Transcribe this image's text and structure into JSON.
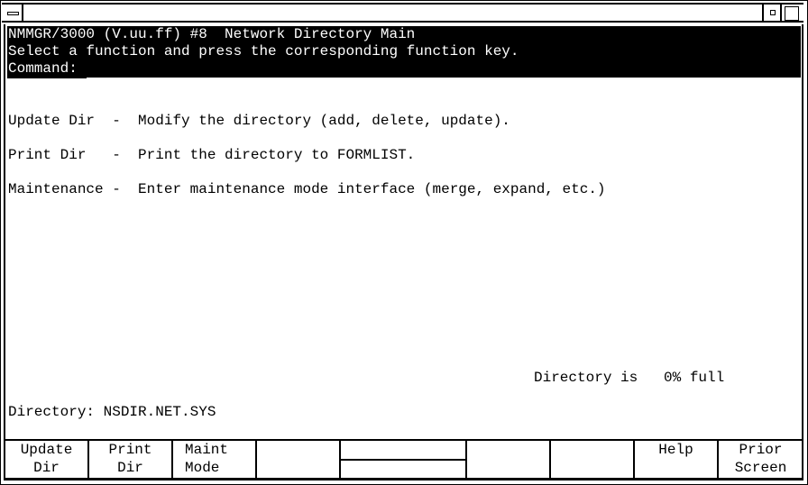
{
  "header": {
    "title": "NMMGR/3000 (V.uu.ff) #8  Network Directory Main",
    "instruction": "Select a function and press the corresponding function key.",
    "command_label": "Command:",
    "command_value": ""
  },
  "menu": [
    {
      "label": "Update Dir  ",
      "sep": "-",
      "desc": "Modify the directory (add, delete, update)."
    },
    {
      "label": "Print Dir   ",
      "sep": "-",
      "desc": "Print the directory to FORMLIST."
    },
    {
      "label": "Maintenance ",
      "sep": "-",
      "desc": "Enter maintenance mode interface (merge, expand, etc.)"
    }
  ],
  "status": {
    "directory_full_text": "Directory is   0% full"
  },
  "directory": {
    "label": "Directory: NSDIR.NET.SYS"
  },
  "function_keys": [
    {
      "line1": "Update",
      "line2": "Dir"
    },
    {
      "line1": "Print",
      "line2": "Dir"
    },
    {
      "line1": "Maint",
      "line2": "Mode"
    },
    {
      "line1": "",
      "line2": ""
    },
    {
      "line1": "",
      "line2": ""
    },
    {
      "line1": "",
      "line2": ""
    },
    {
      "line1": "",
      "line2": ""
    },
    {
      "line1": "Help",
      "line2": ""
    },
    {
      "line1": "Prior",
      "line2": "Screen"
    }
  ]
}
